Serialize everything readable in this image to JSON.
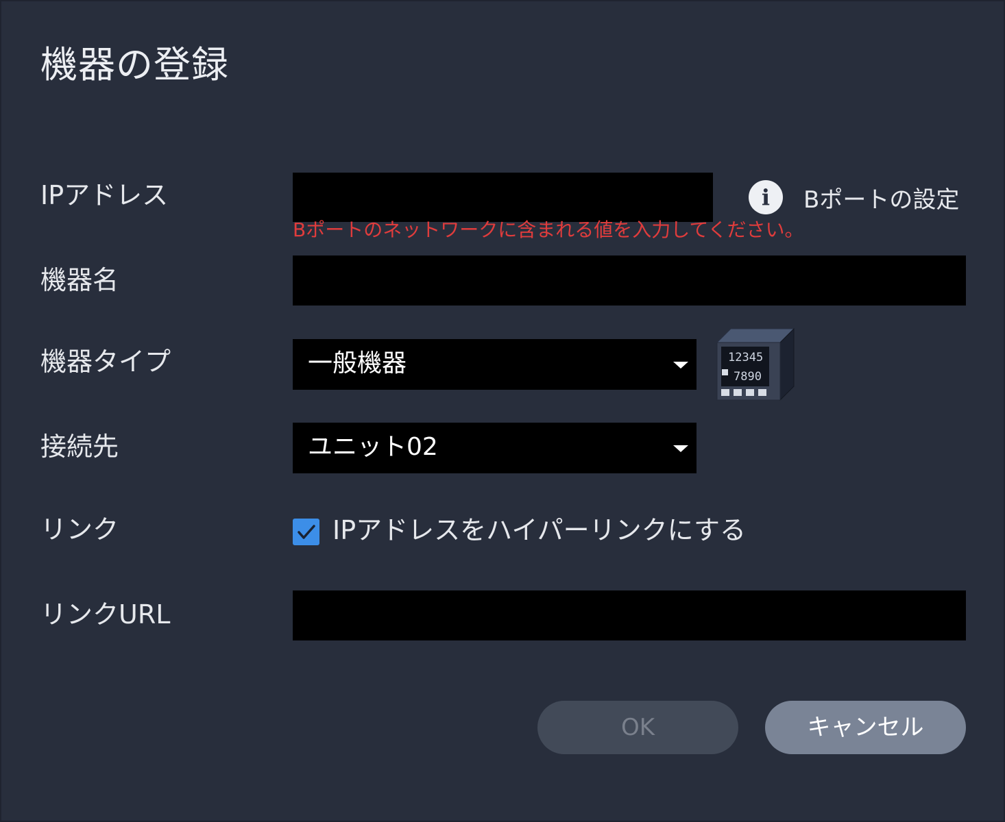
{
  "dialog": {
    "title": "機器の登録"
  },
  "form": {
    "ip_address": {
      "label": "IPアドレス",
      "value": "",
      "error": "Bポートのネットワークに含まれる値を入力してください。"
    },
    "b_port_settings": {
      "label": "Bポートの設定",
      "icon": "info-icon"
    },
    "device_name": {
      "label": "機器名",
      "value": ""
    },
    "device_type": {
      "label": "機器タイプ",
      "selected": "一般機器",
      "image": {
        "name": "general-device-icon",
        "display_row1": "12345",
        "display_row2": "7890"
      }
    },
    "connection": {
      "label": "接続先",
      "selected": "ユニット02"
    },
    "link": {
      "label": "リンク",
      "checkbox_label": "IPアドレスをハイパーリンクにする",
      "checked": true
    },
    "link_url": {
      "label": "リンクURL",
      "value": ""
    }
  },
  "buttons": {
    "ok_label": "OK",
    "ok_enabled": false,
    "cancel_label": "キャンセル"
  },
  "colors": {
    "background": "#282e3c",
    "error": "#e03c3c",
    "checkbox": "#3c8ee8",
    "ok_disabled": "#424a58",
    "cancel": "#7a8496"
  }
}
